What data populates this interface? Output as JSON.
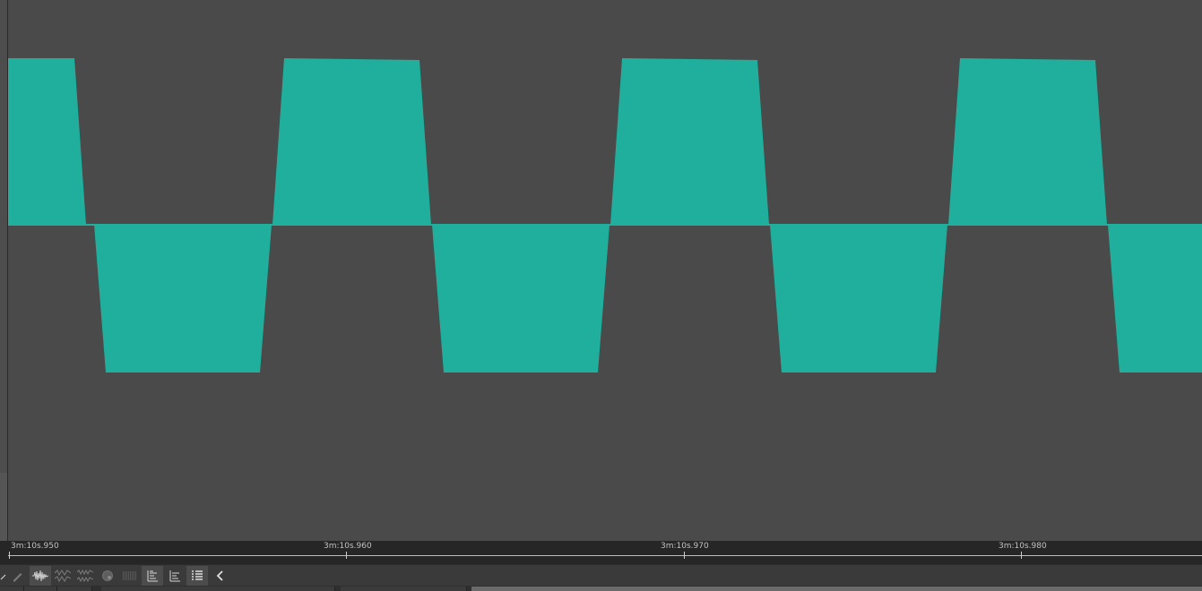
{
  "colors": {
    "background": "#4a4a4a",
    "waveform": "#21af9d",
    "ruler_bg": "#262626",
    "toolbar_bg": "#3a3a3a"
  },
  "timeline": {
    "ticks": [
      {
        "label": "3m:10s.950"
      },
      {
        "label": "3m:10s.960"
      },
      {
        "label": "3m:10s.970"
      },
      {
        "label": "3m:10s.980"
      }
    ]
  },
  "toolbar": {
    "tools": [
      {
        "icon": "pencil-icon",
        "active": false
      },
      {
        "icon": "waveform-icon",
        "active": true
      },
      {
        "icon": "waveform-split-icon",
        "active": false
      },
      {
        "icon": "waveform-stack-icon",
        "active": false
      },
      {
        "icon": "record-icon",
        "active": false
      },
      {
        "icon": "spectrum-icon",
        "active": false
      },
      {
        "icon": "align-lines-icon",
        "active": true
      },
      {
        "icon": "align-lines-alt-icon",
        "active": false
      },
      {
        "icon": "list-icon",
        "active": true
      },
      {
        "icon": "chevron-left-icon",
        "active": false
      }
    ]
  }
}
